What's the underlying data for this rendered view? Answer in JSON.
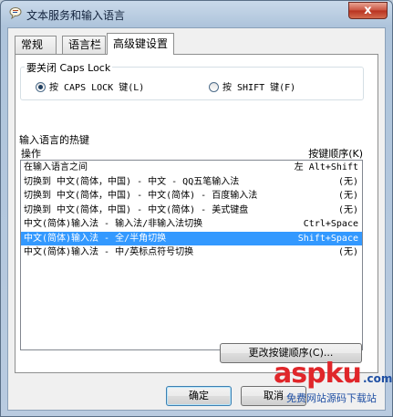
{
  "window": {
    "title": "文本服务和输入语言",
    "close_label": "x"
  },
  "tabs": [
    {
      "label": "常规",
      "active": false
    },
    {
      "label": "语言栏",
      "active": false
    },
    {
      "label": "高级键设置",
      "active": true
    }
  ],
  "caps_lock": {
    "group_label": "要关闭 Caps Lock",
    "option_caps": "按 CAPS LOCK 键(L)",
    "option_shift": "按 SHIFT 键(F)",
    "selected": "caps"
  },
  "hotkeys": {
    "group_label": "输入语言的热键",
    "col_action": "操作",
    "col_keys": "按键顺序(K)",
    "rows": [
      {
        "action": "在输入语言之间",
        "keys": "左 Alt+Shift",
        "selected": false
      },
      {
        "action": "切换到 中文(简体，中国) - 中文 - QQ五笔输入法",
        "keys": "(无)",
        "selected": false
      },
      {
        "action": "切换到 中文(简体，中国) - 中文(简体) - 百度输入法",
        "keys": "(无)",
        "selected": false
      },
      {
        "action": "切换到 中文(简体，中国) - 中文(简体) - 美式键盘",
        "keys": "(无)",
        "selected": false
      },
      {
        "action": "中文(简体)输入法 - 输入法/非输入法切换",
        "keys": "Ctrl+Space",
        "selected": false
      },
      {
        "action": "中文(简体)输入法 - 全/半角切换",
        "keys": "Shift+Space",
        "selected": true
      },
      {
        "action": "中文(简体)输入法 - 中/英标点符号切换",
        "keys": "(无)",
        "selected": false
      }
    ],
    "change_button": "更改按键顺序(C)..."
  },
  "buttons": {
    "ok": "确定",
    "cancel": "取消"
  },
  "watermark": {
    "brand": "aspku",
    "suffix": ".com",
    "tagline": "免费网站源码下载站"
  },
  "colors": {
    "selection": "#3399ff",
    "watermark_red": "#e0262a",
    "watermark_blue": "#1f4fa3"
  },
  "icons": {
    "app": "speech-bubble-icon"
  }
}
